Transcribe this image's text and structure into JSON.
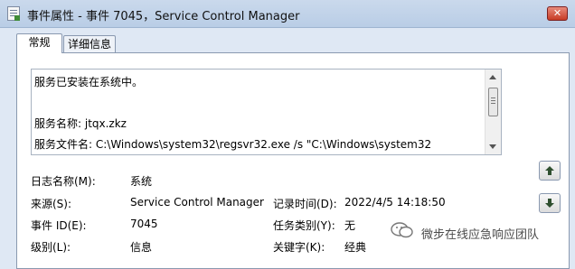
{
  "window": {
    "title": "事件属性 - 事件 7045，Service Control Manager",
    "close_glyph": "✕"
  },
  "tabs": [
    {
      "label": "常规",
      "active": true
    },
    {
      "label": "详细信息",
      "active": false
    }
  ],
  "description": {
    "lines": [
      "服务已安装在系统中。",
      "服务名称:  jtqx.zkz",
      "服务文件名:  C:\\Windows\\system32\\regsvr32.exe /s \"C:\\Windows\\system32"
    ]
  },
  "fields": {
    "log_name": {
      "label": "日志名称(M):",
      "value": "系统"
    },
    "source": {
      "label": "来源(S):",
      "value": "Service Control Manager"
    },
    "logged": {
      "label": "记录时间(D):",
      "value": "2022/4/5 14:18:50"
    },
    "event_id": {
      "label": "事件 ID(E):",
      "value": "7045"
    },
    "task_category": {
      "label": "任务类别(Y):",
      "value": "无"
    },
    "level": {
      "label": "级别(L):",
      "value": "信息"
    },
    "keywords": {
      "label": "关键字(K):",
      "value": "经典"
    }
  },
  "navigation": {
    "up_icon": "arrow-up-icon",
    "down_icon": "arrow-down-icon"
  },
  "watermark": {
    "text": "微步在线应急响应团队"
  },
  "colors": {
    "window_bg": "#dfe8f4",
    "titlebar": "#cad9ec",
    "close_button": "#c73b25",
    "nav_arrow": "#2f4f2f"
  }
}
